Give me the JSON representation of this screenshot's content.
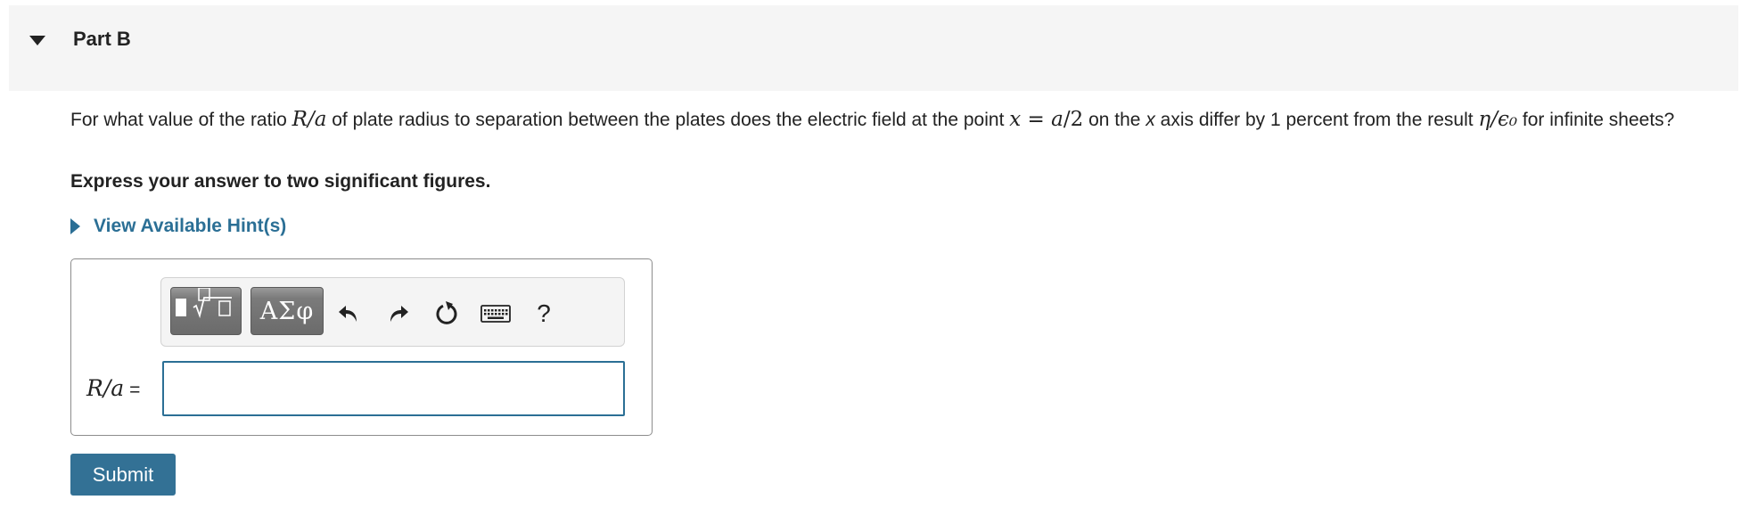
{
  "part": {
    "title": "Part B"
  },
  "question": {
    "text_1": "For what value of the ratio ",
    "math_ratio": "R/a",
    "text_2": " of plate radius to separation between the plates does the electric field at the point ",
    "math_point_lhs": "x",
    "math_point_eq": " = ",
    "math_point_rhs_var": "a",
    "math_point_rhs_rest": "/2",
    "text_3": " on the ",
    "x_axis_var": "x",
    "text_4": " axis differ by 1 percent from the result ",
    "math_result": "η/ϵ₀",
    "text_5": " for infinite sheets?",
    "instruction": "Express your answer to two significant figures."
  },
  "hint": {
    "label": "View Available Hint(s)"
  },
  "toolbar": {
    "symbols_label": "ΑΣφ",
    "help_label": "?",
    "icons": [
      "templates-icon",
      "symbols-icon",
      "undo-icon",
      "redo-icon",
      "reset-icon",
      "keyboard-icon",
      "help-icon"
    ]
  },
  "answer": {
    "label_var": "R/a",
    "label_eq": "=",
    "value": ""
  },
  "submit": {
    "label": "Submit"
  },
  "colors": {
    "accent": "#2b6f95",
    "submit_bg": "#337195",
    "header_bg": "#f5f5f5",
    "toolbar_button": "#6b6b6b"
  }
}
